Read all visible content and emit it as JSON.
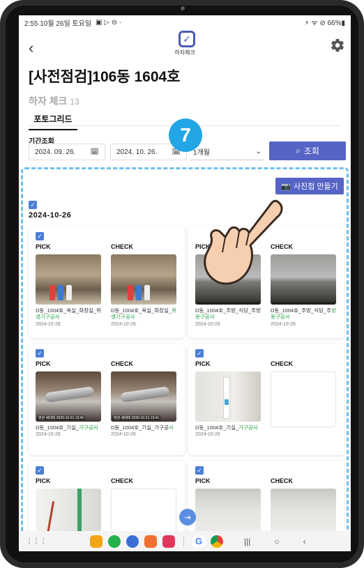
{
  "status_bar": {
    "time_date": "2:55 10월 26일 토요일",
    "right_icons": "⚡ ᯤ ⊘ 66%▮"
  },
  "header": {
    "logo_text": "하자체크",
    "page_title": "[사전점검]106동 1604호"
  },
  "section": {
    "label": "하자 체크",
    "count": "13"
  },
  "tabs": [
    {
      "label": "포토그리드"
    }
  ],
  "filter": {
    "period_label": "기간조회",
    "start_date": "2024. 09. 26.",
    "end_date": "2024. 10. 26.",
    "range_select": "1개월",
    "search_label": "조회"
  },
  "step_badge": "7",
  "album_button": "사진첩 만들기",
  "date_group": "2024-10-26",
  "cards": [
    {
      "pick": {
        "header": "PICK",
        "caption_a": "D동_1004호_욕실_화장실_위",
        "caption_b": "생기구공사",
        "date": "2024-10-26"
      },
      "check": {
        "header": "CHECK",
        "caption_a": "D동_1004호_욕실_화장실_",
        "caption_b": "위생기구공사",
        "date": "2024-10-26"
      }
    },
    {
      "pick": {
        "header": "PICK",
        "caption_a": "D동_1004호_주방_식당_주방",
        "caption_b": "용구공사",
        "date": "2024-10-26"
      },
      "check": {
        "header": "CHECK",
        "caption_a": "D동_1004호_주방_식당_주",
        "caption_b": "방용구공사",
        "date": "2024-10-26"
      }
    },
    {
      "pick": {
        "header": "PICK",
        "caption_a": "D동_1004호_기실_",
        "caption_b": "가구공사",
        "date": "2024-10-26",
        "timestamp": "현관 세대대 2020-10-21 13:41"
      },
      "check": {
        "header": "CHECK",
        "caption_a": "D동_1004호_기실_가구공",
        "caption_b": "사",
        "date": "2024-10-26",
        "timestamp": "현관 세대대 2020-10-21 13:41"
      }
    },
    {
      "pick": {
        "header": "PICK",
        "caption_a": "D동_1004호_기실_",
        "caption_b": "가구공사",
        "date": "2024-10-26"
      },
      "check": {
        "header": "CHECK"
      }
    },
    {
      "pick": {
        "header": "PICK"
      },
      "check": {
        "header": "CHECK"
      }
    },
    {
      "pick": {
        "header": "PICK"
      },
      "check": {
        "header": "CHECK"
      }
    }
  ],
  "colors": {
    "accent": "#5664c6",
    "checkbox": "#4a7fd6",
    "badge": "#23a6e6",
    "highlight_border": "#6ec0ec",
    "caption_highlight": "#2aa04a"
  }
}
